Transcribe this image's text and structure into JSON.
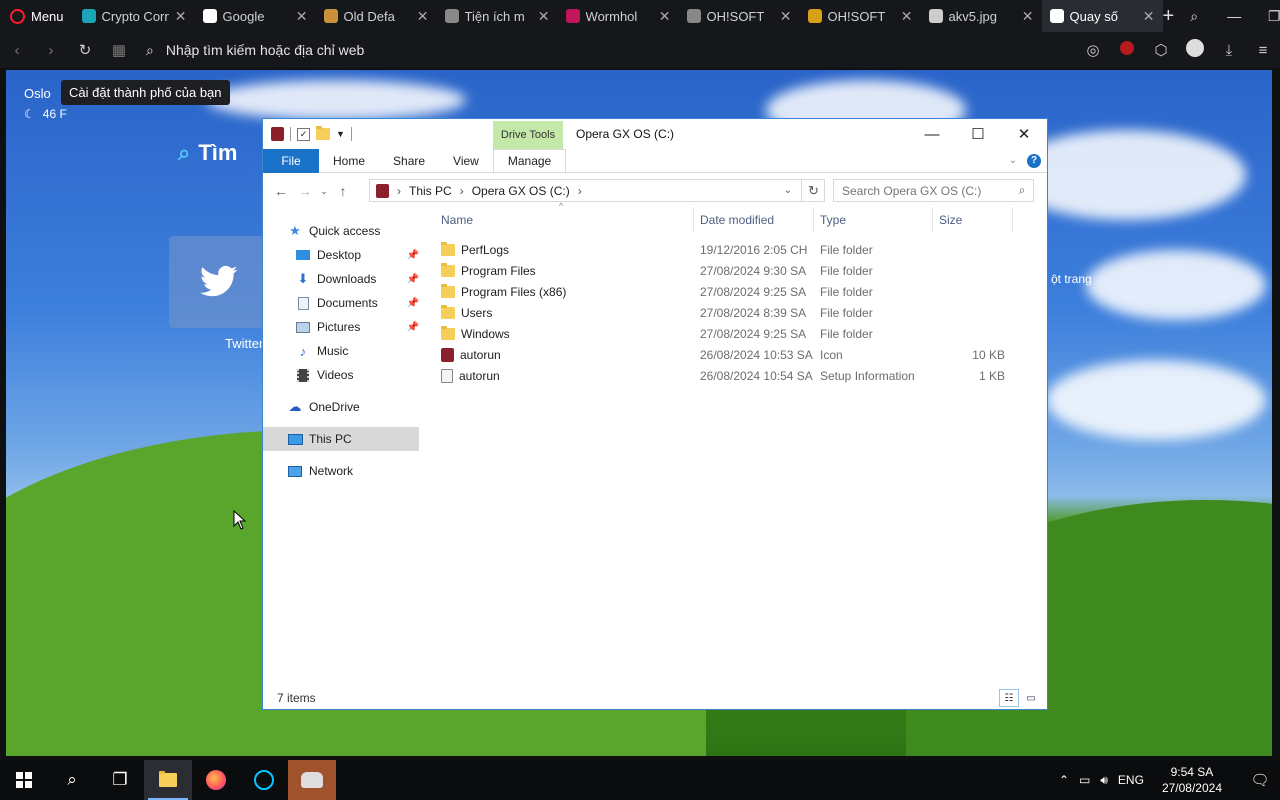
{
  "browser": {
    "menu_label": "Menu",
    "tabs": [
      {
        "label": "Crypto Corne",
        "fav": "tab-favicon-crypto",
        "fav_color": "#1aa6b7"
      },
      {
        "label": "Google",
        "fav": "tab-favicon-google",
        "fav_color": "#ffffff"
      },
      {
        "label": "Old Defa",
        "fav": "tab-favicon-cookie",
        "fav_color": "#c8913a"
      },
      {
        "label": "Tiện ích m",
        "fav": "tab-favicon-puzzle",
        "fav_color": "#888888"
      },
      {
        "label": "Wormhol",
        "fav": "tab-favicon-wormhole",
        "fav_color": "#c2185b"
      },
      {
        "label": "OH!SOFT",
        "fav": "tab-favicon-ohsoft",
        "fav_color": "#888888"
      },
      {
        "label": "OH!SOFT",
        "fav": "tab-favicon-ohsoft-2",
        "fav_color": "#d6a017"
      },
      {
        "label": "akv5.jpg",
        "fav": "tab-favicon-globe",
        "fav_color": "#cccccc"
      },
      {
        "label": "Quay số",
        "fav": "tab-favicon-grid",
        "fav_color": "#ffffff",
        "active": true
      }
    ],
    "address_placeholder": "Nhập tìm kiếm hoặc địa chỉ web"
  },
  "speed_dial": {
    "city": "Oslo",
    "city_tooltip": "Cài đặt thành phố của bạn",
    "temperature": "46 F",
    "search_label": "Tìm",
    "twitter_label": "Twitter",
    "add_site_label": "ột trang"
  },
  "explorer": {
    "title": "Opera GX OS (C:)",
    "drive_tools": "Drive Tools",
    "ribbon_tabs": [
      "File",
      "Home",
      "Share",
      "View",
      "Manage"
    ],
    "breadcrumb": [
      "This PC",
      "Opera GX OS (C:)"
    ],
    "search_placeholder": "Search Opera GX OS (C:)",
    "nav": {
      "quick_access": "Quick access",
      "quick_items": [
        "Desktop",
        "Downloads",
        "Documents",
        "Pictures",
        "Music",
        "Videos"
      ],
      "onedrive": "OneDrive",
      "this_pc": "This PC",
      "network": "Network"
    },
    "columns": {
      "name": "Name",
      "date": "Date modified",
      "type": "Type",
      "size": "Size"
    },
    "files": [
      {
        "name": "PerfLogs",
        "date": "19/12/2016 2:05 CH",
        "type": "File folder",
        "size": "",
        "icon": "folder-icon"
      },
      {
        "name": "Program Files",
        "date": "27/08/2024 9:30 SA",
        "type": "File folder",
        "size": "",
        "icon": "folder-icon"
      },
      {
        "name": "Program Files (x86)",
        "date": "27/08/2024 9:25 SA",
        "type": "File folder",
        "size": "",
        "icon": "folder-icon"
      },
      {
        "name": "Users",
        "date": "27/08/2024 8:39 SA",
        "type": "File folder",
        "size": "",
        "icon": "folder-icon"
      },
      {
        "name": "Windows",
        "date": "27/08/2024 9:25 SA",
        "type": "File folder",
        "size": "",
        "icon": "folder-icon"
      },
      {
        "name": "autorun",
        "date": "26/08/2024 10:53 SA",
        "type": "Icon",
        "size": "10 KB",
        "icon": "opera-gx-icon"
      },
      {
        "name": "autorun",
        "date": "26/08/2024 10:54 SA",
        "type": "Setup Information",
        "size": "1 KB",
        "icon": "setup-info-icon"
      }
    ],
    "status": "7 items"
  },
  "taskbar": {
    "language": "ENG",
    "time": "9:54 SA",
    "date": "27/08/2024"
  }
}
